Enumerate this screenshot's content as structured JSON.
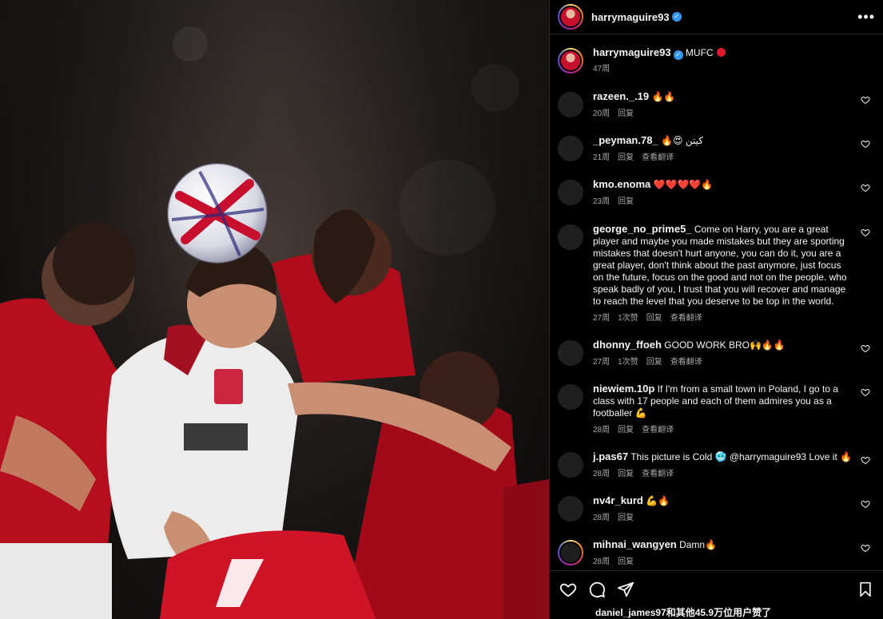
{
  "post": {
    "author": "harrymaguire93",
    "caption": {
      "username": "harrymaguire93",
      "text": "MUFC",
      "time": "47周"
    },
    "likes_text": "daniel_james97和其他45.9万位用户赞了"
  },
  "labels": {
    "reply": "回复",
    "see_translation": "查看翻译",
    "more_glyph": "•••"
  },
  "comments": [
    {
      "username": "razeen._.19",
      "text": "🔥🔥",
      "time": "20周",
      "likes": "",
      "translate": false
    },
    {
      "username": "_peyman.78_",
      "text": "🔥😍 كيتن",
      "time": "21周",
      "likes": "",
      "translate": true
    },
    {
      "username": "kmo.enoma",
      "text": "❤️❤️❤️❤️🔥",
      "time": "23周",
      "likes": "",
      "translate": false
    },
    {
      "username": "george_no_prime5_",
      "text": "Come on Harry, you are a great player and maybe you made mistakes but they are sporting mistakes that doesn't hurt anyone, you can do it, you are a great player, don't think about the past anymore, just focus on the future, focus on the good and not on the people. who speak badly of you, I trust that you will recover and manage to reach the level that you deserve to be top in the world.",
      "time": "27周",
      "likes": "1次赞",
      "translate": true
    },
    {
      "username": "dhonny_ffoeh",
      "text": "GOOD WORK BRO🙌🔥🔥",
      "time": "27周",
      "likes": "1次赞",
      "translate": true
    },
    {
      "username": "niewiem.10p",
      "text": "If I'm from a small town in Poland, I go to a class with 17 people and each of them admires you as a footballer 💪",
      "time": "28周",
      "likes": "",
      "translate": true
    },
    {
      "username": "j.pas67",
      "text": "This picture is Cold 🥶 @harrymaguire93 Love it 🔥",
      "time": "28周",
      "likes": "",
      "translate": true
    },
    {
      "username": "nv4r_kurd",
      "text": "💪🔥",
      "time": "28周",
      "likes": "",
      "translate": false
    },
    {
      "username": "mihnai_wangyen",
      "text": "Damn🔥",
      "time": "28周",
      "likes": "",
      "translate": false
    }
  ],
  "icons": {
    "like": "heart-icon",
    "comment": "comment-icon",
    "share": "share-icon",
    "save": "bookmark-icon",
    "verified": "verified-badge-icon"
  },
  "colors": {
    "background": "#000000",
    "verified": "#3897f0",
    "muted_text": "#a8a8a8",
    "kit_red": "#c8102e"
  }
}
